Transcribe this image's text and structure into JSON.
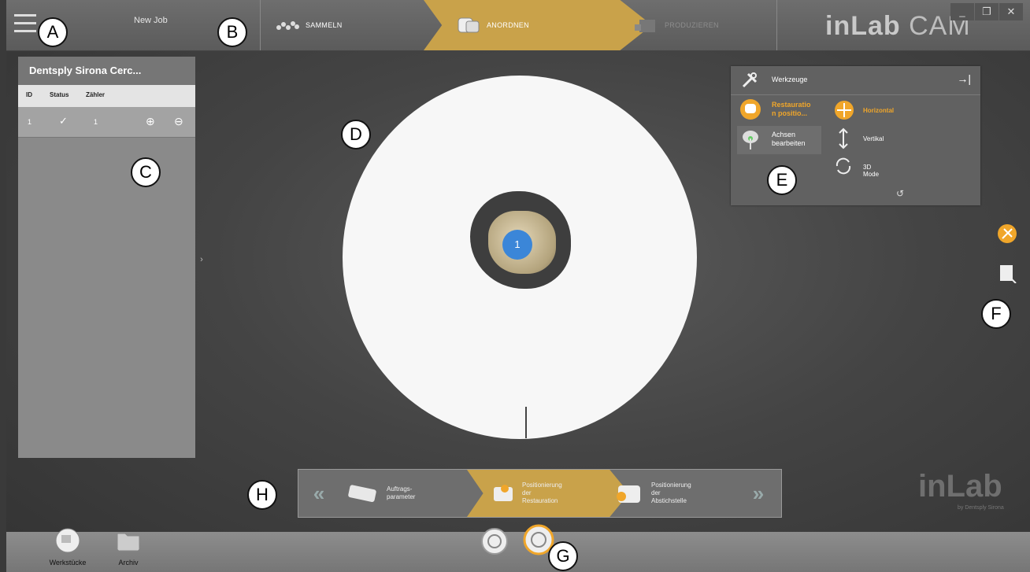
{
  "app": {
    "job_name": "New Job",
    "brand_bold": "inLab",
    "brand_light": "CAM"
  },
  "window_controls": {
    "minimize": "_",
    "restore": "❐",
    "close": "✕"
  },
  "phases": [
    {
      "label": "SAMMELN",
      "state": "done"
    },
    {
      "label": "ANORDNEN",
      "state": "active"
    },
    {
      "label": "PRODUZIEREN",
      "state": "disabled"
    }
  ],
  "job_panel": {
    "title": "Dentsply Sirona Cerc...",
    "columns": [
      "ID",
      "Status",
      "Zähler"
    ],
    "rows": [
      {
        "id": "1",
        "status": "✓",
        "count": "1",
        "add": "⊕",
        "remove": "⊖"
      }
    ]
  },
  "collapse_toggle": "›",
  "restoration_marker": "1",
  "tools": {
    "header": "Werkzeuge",
    "pin": "→|",
    "left_items": [
      {
        "label_line1": "Restauratio",
        "label_line2": "n positio...",
        "active": true
      },
      {
        "label_line1": "Achsen",
        "label_line2": "bearbeiten",
        "active": false
      }
    ],
    "right_items": [
      {
        "label": "Horizontal",
        "active": true
      },
      {
        "label": "Vertikal",
        "active": false
      },
      {
        "label": "3D Mode",
        "active": false
      }
    ],
    "reset_icon": "↺"
  },
  "stepper": {
    "back": "«",
    "forward": "»",
    "steps": [
      {
        "line1": "Auftrags-",
        "line2": "parameter",
        "line3": "",
        "line4": ""
      },
      {
        "line1": "Positionierung",
        "line2": "der",
        "line3": "Restauration",
        "line4": ""
      },
      {
        "line1": "Positionierung",
        "line2": "der",
        "line3": "Abstichstelle",
        "line4": ""
      }
    ]
  },
  "watermark": {
    "logo": "inLab",
    "by": "by Dentsply Sirona"
  },
  "bottom": {
    "workpieces": "Werkstücke",
    "archive": "Archiv"
  },
  "callouts": {
    "a": "A",
    "b": "B",
    "c": "C",
    "d": "D",
    "e": "E",
    "f": "F",
    "g": "G",
    "h": "H"
  },
  "colors": {
    "accent": "#c9a24a",
    "highlight": "#f0a62a",
    "marker": "#3b86d8"
  }
}
